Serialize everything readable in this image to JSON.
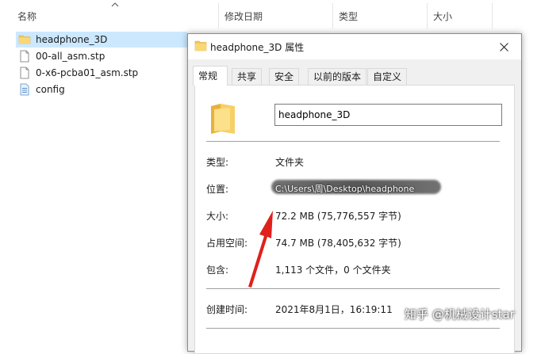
{
  "columns": {
    "name": "名称",
    "modified": "修改日期",
    "type": "类型",
    "size": "大小"
  },
  "files": [
    {
      "name": "headphone_3D",
      "icon": "folder-icon",
      "selected": true
    },
    {
      "name": "00-all_asm.stp",
      "icon": "file-icon",
      "selected": false
    },
    {
      "name": "0-x6-pcba01_asm.stp",
      "icon": "file-icon",
      "selected": false
    },
    {
      "name": "config",
      "icon": "config-file-icon",
      "selected": false
    }
  ],
  "dialog": {
    "title": "headphone_3D 属性",
    "tabs": [
      "常规",
      "共享",
      "安全",
      "以前的版本",
      "自定义"
    ],
    "active_tab": "常规",
    "folder_name": "headphone_3D",
    "properties": {
      "type_label": "类型:",
      "type_value": "文件夹",
      "location_label": "位置:",
      "location_value": "C:\\Users\\周\\Desktop\\headphone",
      "size_label": "大小:",
      "size_value": "72.2 MB (75,776,557 字节)",
      "disk_size_label": "占用空间:",
      "disk_size_value": "74.7 MB (78,405,632 字节)",
      "contains_label": "包含:",
      "contains_value": "1,113 个文件，0 个文件夹",
      "created_label": "创建时间:",
      "created_value": "2021年8月1日，16:19:11"
    }
  },
  "watermark": "知乎 @机械设计star",
  "colors": {
    "selection": "#cce8ff",
    "folder": "#f4c65a",
    "arrow": "#e0201b"
  }
}
